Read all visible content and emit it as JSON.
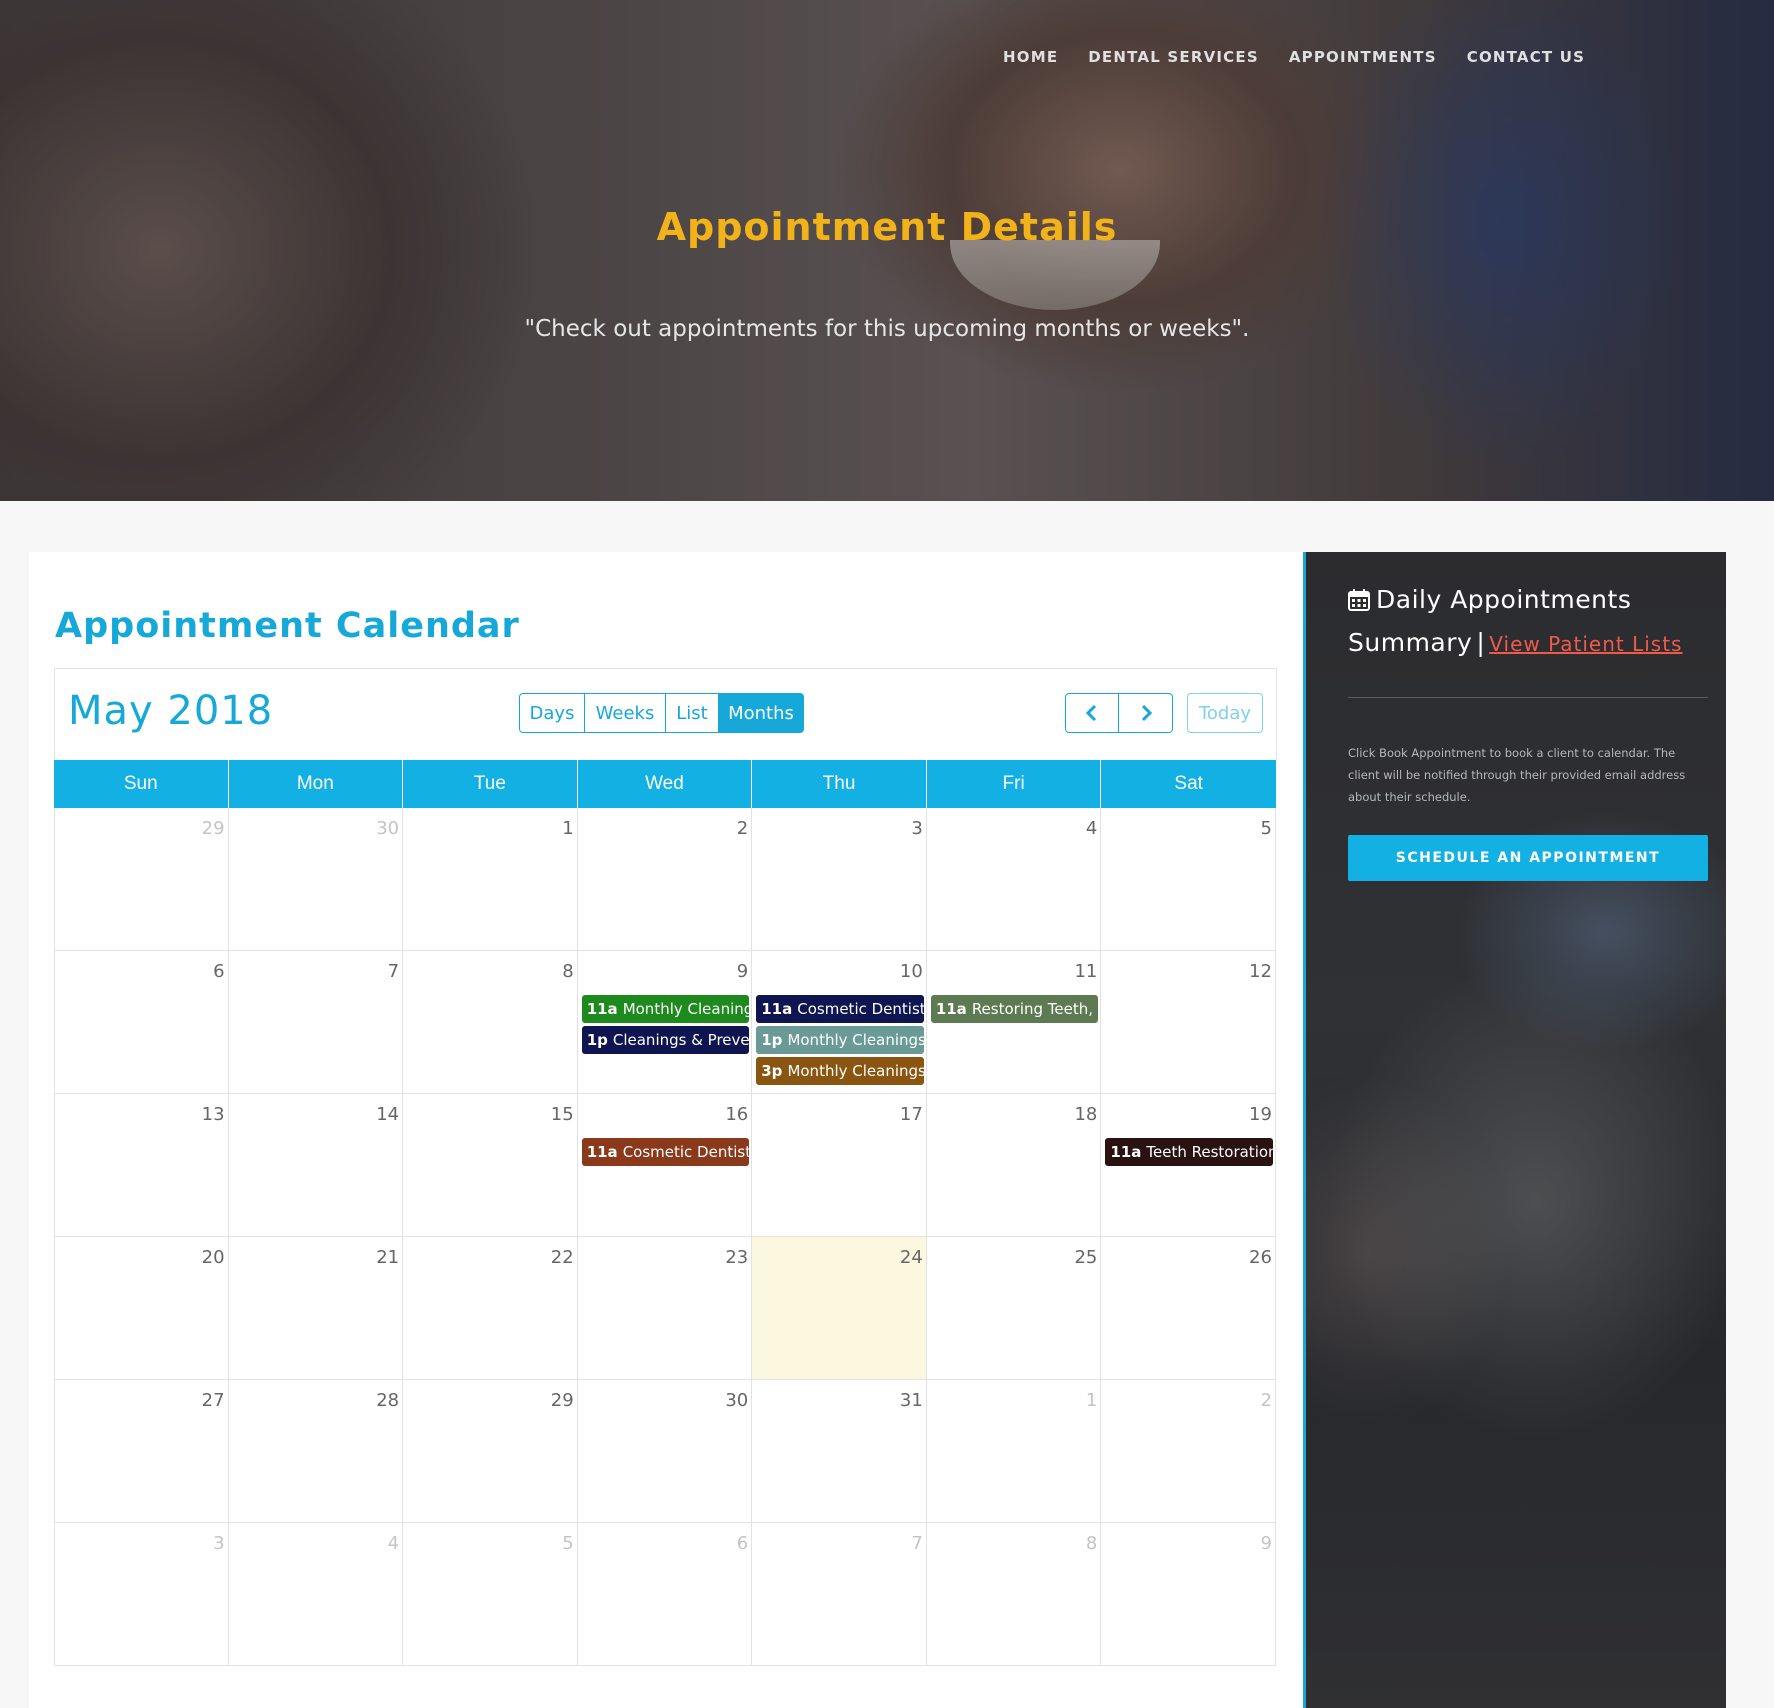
{
  "nav": {
    "items": [
      "HOME",
      "DENTAL SERVICES",
      "APPOINTMENTS",
      "CONTACT US"
    ]
  },
  "hero": {
    "title": "Appointment Details",
    "subtitle": "\"Check out appointments for this upcoming months or weeks\"."
  },
  "calendar": {
    "heading": "Appointment Calendar",
    "month_title": "May 2018",
    "views": [
      "Days",
      "Weeks",
      "List",
      "Months"
    ],
    "active_view": "Months",
    "today_label": "Today",
    "weekdays": [
      "Sun",
      "Mon",
      "Tue",
      "Wed",
      "Thu",
      "Fri",
      "Sat"
    ],
    "weeks": [
      [
        {
          "d": "29",
          "o": true
        },
        {
          "d": "30",
          "o": true
        },
        {
          "d": "1"
        },
        {
          "d": "2"
        },
        {
          "d": "3"
        },
        {
          "d": "4"
        },
        {
          "d": "5"
        }
      ],
      [
        {
          "d": "6"
        },
        {
          "d": "7"
        },
        {
          "d": "8"
        },
        {
          "d": "9",
          "events": [
            {
              "time": "11a",
              "title": "Monthly Cleanings",
              "color": "#1e8a1e"
            },
            {
              "time": "1p",
              "title": "Cleanings & Prevention",
              "color": "#0f1550"
            }
          ]
        },
        {
          "d": "10",
          "events": [
            {
              "time": "11a",
              "title": "Cosmetic Dentistry",
              "color": "#0f1550"
            },
            {
              "time": "1p",
              "title": "Monthly Cleanings & Prevention",
              "color": "#6a9a96"
            },
            {
              "time": "3p",
              "title": "Monthly Cleanings & Prevention",
              "color": "#8a5510"
            }
          ]
        },
        {
          "d": "11",
          "events": [
            {
              "time": "11a",
              "title": "Restoring Teeth, Crowns",
              "color": "#5e7a52"
            }
          ]
        },
        {
          "d": "12"
        }
      ],
      [
        {
          "d": "13"
        },
        {
          "d": "14"
        },
        {
          "d": "15"
        },
        {
          "d": "16",
          "events": [
            {
              "time": "11a",
              "title": "Cosmetic Dentistry",
              "color": "#8a3a1a"
            }
          ]
        },
        {
          "d": "17"
        },
        {
          "d": "18"
        },
        {
          "d": "19",
          "events": [
            {
              "time": "11a",
              "title": "Teeth Restoration",
              "color": "#2a1210"
            }
          ]
        }
      ],
      [
        {
          "d": "20"
        },
        {
          "d": "21"
        },
        {
          "d": "22"
        },
        {
          "d": "23"
        },
        {
          "d": "24",
          "today": true
        },
        {
          "d": "25"
        },
        {
          "d": "26"
        }
      ],
      [
        {
          "d": "27"
        },
        {
          "d": "28"
        },
        {
          "d": "29"
        },
        {
          "d": "30"
        },
        {
          "d": "31"
        },
        {
          "d": "1",
          "o": true
        },
        {
          "d": "2",
          "o": true
        }
      ],
      [
        {
          "d": "3",
          "o": true
        },
        {
          "d": "4",
          "o": true
        },
        {
          "d": "5",
          "o": true
        },
        {
          "d": "6",
          "o": true
        },
        {
          "d": "7",
          "o": true
        },
        {
          "d": "8",
          "o": true
        },
        {
          "d": "9",
          "o": true
        }
      ]
    ]
  },
  "sidebar": {
    "title_line1": "Daily Appointments",
    "title_line2": "Summary",
    "separator": "|",
    "link": "View Patient Lists",
    "description": "Click Book Appointment to book a client to calendar. The client will be notified through their provided email address about their schedule.",
    "button": "SCHEDULE AN APPOINTMENT",
    "icon": "calendar-icon"
  },
  "colors": {
    "accent": "#13b1e3",
    "hero_title": "#f2b21a",
    "link_red": "#f05a4a",
    "today_bg": "#fcf7df"
  }
}
